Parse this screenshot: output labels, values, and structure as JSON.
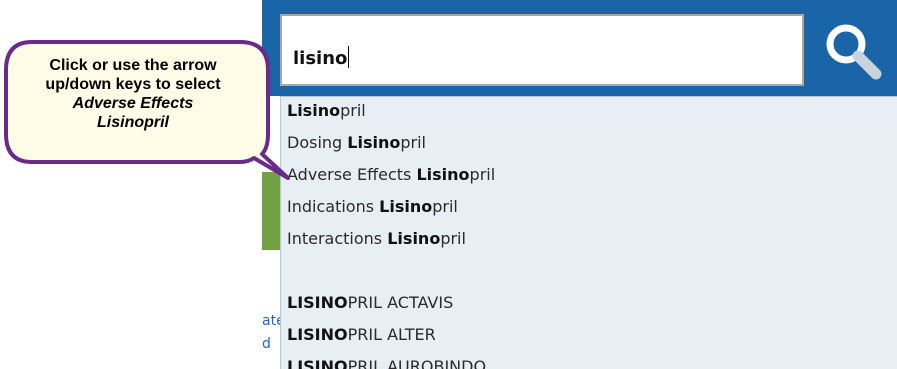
{
  "search": {
    "value": "lisino",
    "button_icon": "search-icon"
  },
  "suggestions": [
    {
      "prefix": "",
      "match": "Lisino",
      "suffix": "pril"
    },
    {
      "prefix": "Dosing ",
      "match": "Lisino",
      "suffix": "pril"
    },
    {
      "prefix": "Adverse Effects ",
      "match": "Lisino",
      "suffix": "pril"
    },
    {
      "prefix": "Indications ",
      "match": "Lisino",
      "suffix": "pril"
    },
    {
      "prefix": "Interactions ",
      "match": "Lisino",
      "suffix": "pril"
    },
    {
      "prefix": "",
      "match": "LISINO",
      "suffix": "PRIL ACTAVIS"
    },
    {
      "prefix": "",
      "match": "LISINO",
      "suffix": "PRIL ALTER"
    },
    {
      "prefix": "",
      "match": "LISINO",
      "suffix": "PRIL AUROBINDO"
    }
  ],
  "callout": {
    "line1": "Click or use the arrow",
    "line2": "up/down keys to select",
    "line3": "Adverse Effects",
    "line4": "Lisinopril"
  },
  "page_fragments": {
    "frag1": "ate",
    "frag2": "d"
  },
  "colors": {
    "header_blue": "#1a64a8",
    "dropdown_bg": "#e7eef4",
    "callout_border": "#6a2a8a",
    "callout_fill": "#fffde8",
    "accent_green": "#71a143"
  }
}
